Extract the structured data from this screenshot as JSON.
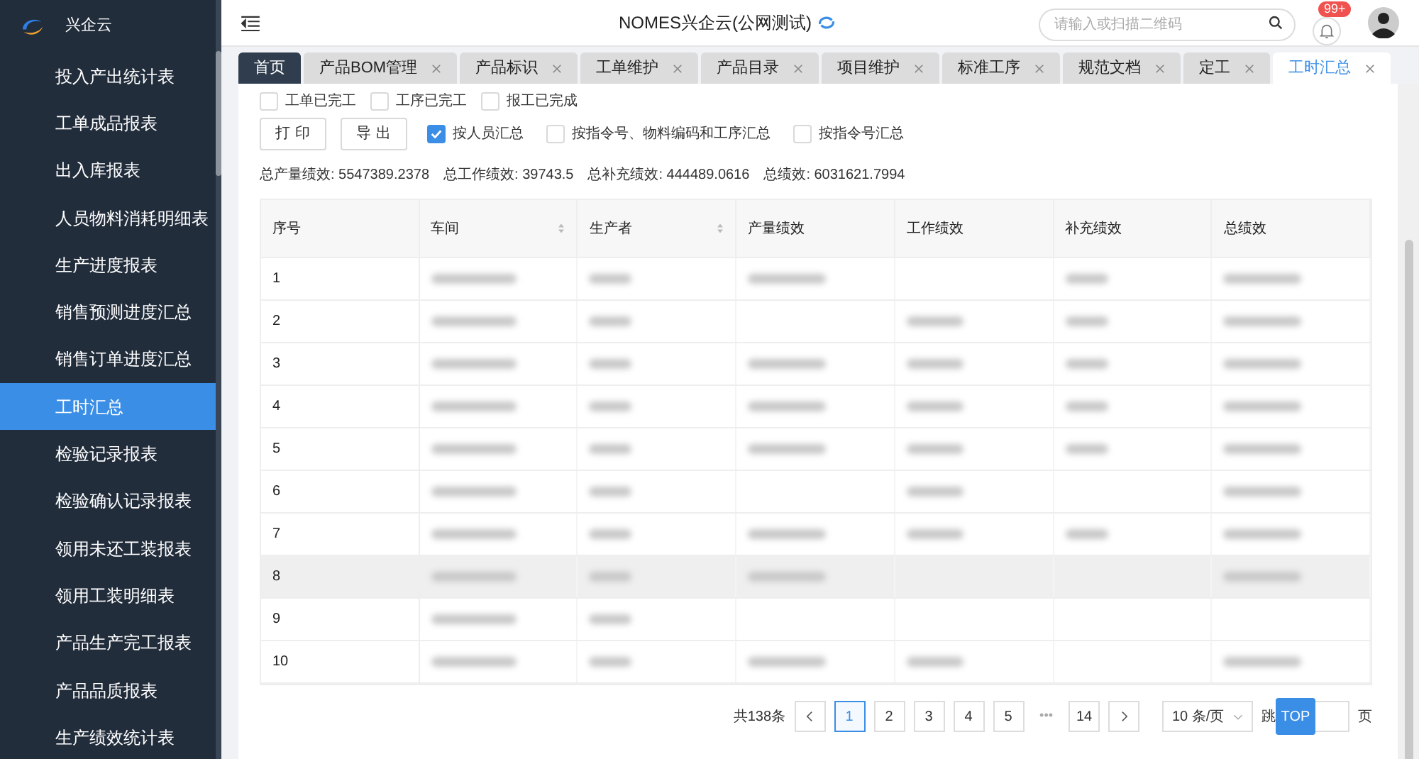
{
  "brand": {
    "name": "兴企云"
  },
  "sidebar": {
    "items": [
      {
        "label": "投入产出统计表",
        "selected": false
      },
      {
        "label": "工单成品报表",
        "selected": false
      },
      {
        "label": "出入库报表",
        "selected": false
      },
      {
        "label": "人员物料消耗明细表",
        "selected": false
      },
      {
        "label": "生产进度报表",
        "selected": false
      },
      {
        "label": "销售预测进度汇总",
        "selected": false
      },
      {
        "label": "销售订单进度汇总",
        "selected": false
      },
      {
        "label": "工时汇总",
        "selected": true
      },
      {
        "label": "检验记录报表",
        "selected": false
      },
      {
        "label": "检验确认记录报表",
        "selected": false
      },
      {
        "label": "领用未还工装报表",
        "selected": false
      },
      {
        "label": "领用工装明细表",
        "selected": false
      },
      {
        "label": "产品生产完工报表",
        "selected": false
      },
      {
        "label": "产品品质报表",
        "selected": false
      },
      {
        "label": "生产绩效统计表",
        "selected": false
      }
    ]
  },
  "header": {
    "title": "NOMES兴企云(公网测试)",
    "search": {
      "placeholder": "请输入或扫描二维码"
    },
    "badge": "99+"
  },
  "tabs": [
    {
      "label": "首页",
      "kind": "home",
      "selected": false
    },
    {
      "label": "产品BOM管理",
      "kind": "closable",
      "selected": false
    },
    {
      "label": "产品标识",
      "kind": "closable",
      "selected": false
    },
    {
      "label": "工单维护",
      "kind": "closable",
      "selected": false
    },
    {
      "label": "产品目录",
      "kind": "closable",
      "selected": false
    },
    {
      "label": "项目维护",
      "kind": "closable",
      "selected": false
    },
    {
      "label": "标准工序",
      "kind": "closable",
      "selected": false
    },
    {
      "label": "规范文档",
      "kind": "closable",
      "selected": false
    },
    {
      "label": "定工",
      "kind": "closable",
      "selected": false
    },
    {
      "label": "工时汇总",
      "kind": "closable",
      "selected": true
    }
  ],
  "filters": [
    {
      "label": "工单已完工",
      "checked": false
    },
    {
      "label": "工序已完工",
      "checked": false
    },
    {
      "label": "报工已完成",
      "checked": false
    }
  ],
  "buttons": [
    "打 印",
    "导 出"
  ],
  "group_options": [
    {
      "label": "按人员汇总",
      "checked": true
    },
    {
      "label": "按指令号、物料编码和工序汇总",
      "checked": false
    },
    {
      "label": "按指令号汇总",
      "checked": false
    }
  ],
  "totals": [
    "总产量绩效: 5547389.2378",
    "总工作绩效: 39743.5",
    "总补充绩效: 444489.0616",
    "总绩效: 6031621.7994"
  ],
  "table": {
    "columns": [
      {
        "label": "序号",
        "sortable": false
      },
      {
        "label": "车间",
        "sortable": true
      },
      {
        "label": "生产者",
        "sortable": true
      },
      {
        "label": "产量绩效",
        "sortable": false
      },
      {
        "label": "工作绩效",
        "sortable": false
      },
      {
        "label": "补充绩效",
        "sortable": false
      },
      {
        "label": "总绩效",
        "sortable": false
      }
    ],
    "rows": [
      {
        "index": "1",
        "highlighted": false,
        "blurred": [
          true,
          true,
          true,
          false,
          true,
          true
        ]
      },
      {
        "index": "2",
        "highlighted": false,
        "blurred": [
          true,
          true,
          false,
          true,
          true,
          true
        ]
      },
      {
        "index": "3",
        "highlighted": false,
        "blurred": [
          true,
          true,
          true,
          true,
          true,
          true
        ]
      },
      {
        "index": "4",
        "highlighted": false,
        "blurred": [
          true,
          true,
          true,
          true,
          true,
          true
        ]
      },
      {
        "index": "5",
        "highlighted": false,
        "blurred": [
          true,
          true,
          true,
          true,
          true,
          true
        ]
      },
      {
        "index": "6",
        "highlighted": false,
        "blurred": [
          true,
          true,
          false,
          true,
          false,
          true
        ]
      },
      {
        "index": "7",
        "highlighted": false,
        "blurred": [
          true,
          true,
          true,
          true,
          true,
          true
        ]
      },
      {
        "index": "8",
        "highlighted": true,
        "blurred": [
          true,
          true,
          true,
          false,
          false,
          true
        ]
      },
      {
        "index": "9",
        "highlighted": false,
        "blurred": [
          true,
          true,
          false,
          false,
          false,
          false
        ]
      },
      {
        "index": "10",
        "highlighted": false,
        "blurred": [
          true,
          true,
          true,
          true,
          false,
          true
        ]
      }
    ]
  },
  "pagination": {
    "total": "共138条",
    "pages": [
      {
        "label": "1",
        "selected": true
      },
      {
        "label": "2",
        "selected": false
      },
      {
        "label": "3",
        "selected": false
      },
      {
        "label": "4",
        "selected": false
      },
      {
        "label": "5",
        "selected": false
      },
      {
        "label": "•••",
        "kind": "ellipsis",
        "selected": false
      },
      {
        "label": "14",
        "selected": false
      }
    ],
    "page_size": "10 条/页",
    "jump_label": "跳",
    "page_unit": "页"
  },
  "top_button": "TOP"
}
